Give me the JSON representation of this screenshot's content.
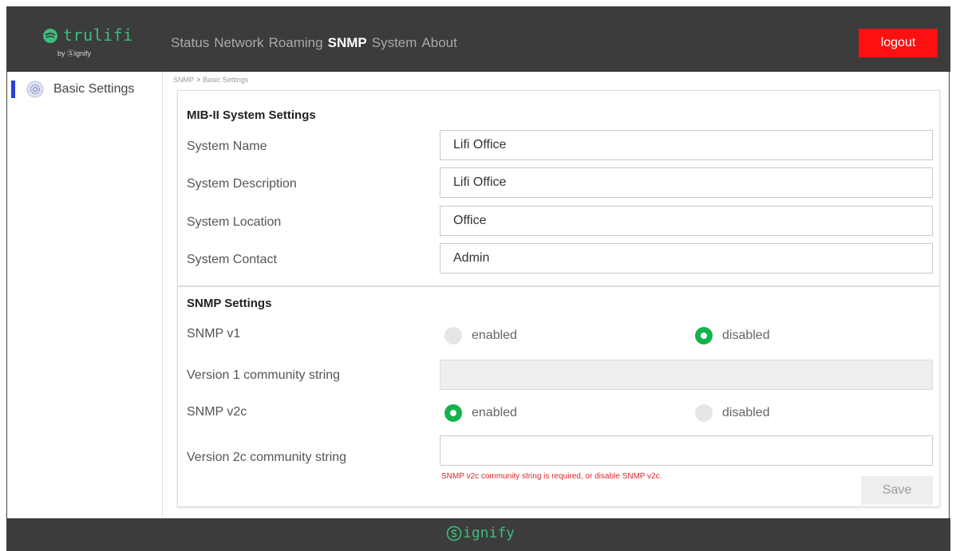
{
  "header": {
    "brand": "trulifi",
    "brand_sub": "by Ⓢignify",
    "nav": [
      {
        "label": "Status",
        "active": false
      },
      {
        "label": "Network",
        "active": false
      },
      {
        "label": "Roaming",
        "active": false
      },
      {
        "label": "SNMP",
        "active": true
      },
      {
        "label": "System",
        "active": false
      },
      {
        "label": "About",
        "active": false
      }
    ],
    "logout_label": "logout"
  },
  "sidebar": {
    "items": [
      {
        "label": "Basic Settings",
        "icon": "gear-icon",
        "active": true
      }
    ]
  },
  "breadcrumb": {
    "parent": "SNMP",
    "separator": ">",
    "current": "Basic Settings"
  },
  "mib": {
    "title": "MIB-II System Settings",
    "system_name": {
      "label": "System Name",
      "value": "Lifi Office"
    },
    "system_description": {
      "label": "System Description",
      "value": "Lifi Office"
    },
    "system_location": {
      "label": "System Location",
      "value": "Office"
    },
    "system_contact": {
      "label": "System Contact",
      "value": "Admin"
    }
  },
  "snmp": {
    "title": "SNMP Settings",
    "v1": {
      "label": "SNMP v1",
      "enabled_label": "enabled",
      "disabled_label": "disabled",
      "selected": "disabled"
    },
    "v1_community": {
      "label": "Version 1 community string",
      "value": ""
    },
    "v2c": {
      "label": "SNMP v2c",
      "enabled_label": "enabled",
      "disabled_label": "disabled",
      "selected": "enabled"
    },
    "v2c_community": {
      "label": "Version 2c community string",
      "value": ""
    },
    "error": "SNMP v2c community string is required, or disable SNMP v2c.",
    "save_label": "Save"
  },
  "footer": {
    "brand": "ignify"
  },
  "colors": {
    "header_bg": "#3c3c3c",
    "brand_green": "#3dbd7a",
    "logout_red": "#ff1010",
    "radio_green": "#14b24b",
    "sidebar_marker": "#2a3fd6",
    "error_red": "#e0262c"
  }
}
